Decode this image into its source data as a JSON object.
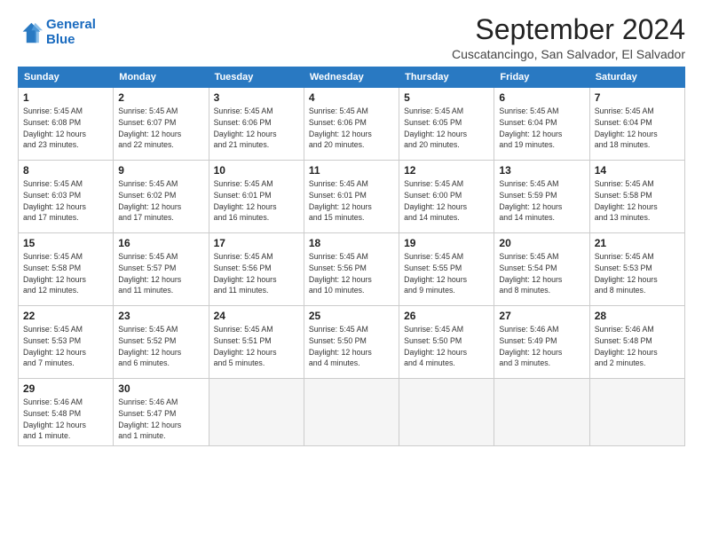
{
  "logo": {
    "line1": "General",
    "line2": "Blue"
  },
  "title": "September 2024",
  "location": "Cuscatancingo, San Salvador, El Salvador",
  "headers": [
    "Sunday",
    "Monday",
    "Tuesday",
    "Wednesday",
    "Thursday",
    "Friday",
    "Saturday"
  ],
  "weeks": [
    [
      {
        "day": "1",
        "info": "Sunrise: 5:45 AM\nSunset: 6:08 PM\nDaylight: 12 hours\nand 23 minutes."
      },
      {
        "day": "2",
        "info": "Sunrise: 5:45 AM\nSunset: 6:07 PM\nDaylight: 12 hours\nand 22 minutes."
      },
      {
        "day": "3",
        "info": "Sunrise: 5:45 AM\nSunset: 6:06 PM\nDaylight: 12 hours\nand 21 minutes."
      },
      {
        "day": "4",
        "info": "Sunrise: 5:45 AM\nSunset: 6:06 PM\nDaylight: 12 hours\nand 20 minutes."
      },
      {
        "day": "5",
        "info": "Sunrise: 5:45 AM\nSunset: 6:05 PM\nDaylight: 12 hours\nand 20 minutes."
      },
      {
        "day": "6",
        "info": "Sunrise: 5:45 AM\nSunset: 6:04 PM\nDaylight: 12 hours\nand 19 minutes."
      },
      {
        "day": "7",
        "info": "Sunrise: 5:45 AM\nSunset: 6:04 PM\nDaylight: 12 hours\nand 18 minutes."
      }
    ],
    [
      {
        "day": "8",
        "info": "Sunrise: 5:45 AM\nSunset: 6:03 PM\nDaylight: 12 hours\nand 17 minutes."
      },
      {
        "day": "9",
        "info": "Sunrise: 5:45 AM\nSunset: 6:02 PM\nDaylight: 12 hours\nand 17 minutes."
      },
      {
        "day": "10",
        "info": "Sunrise: 5:45 AM\nSunset: 6:01 PM\nDaylight: 12 hours\nand 16 minutes."
      },
      {
        "day": "11",
        "info": "Sunrise: 5:45 AM\nSunset: 6:01 PM\nDaylight: 12 hours\nand 15 minutes."
      },
      {
        "day": "12",
        "info": "Sunrise: 5:45 AM\nSunset: 6:00 PM\nDaylight: 12 hours\nand 14 minutes."
      },
      {
        "day": "13",
        "info": "Sunrise: 5:45 AM\nSunset: 5:59 PM\nDaylight: 12 hours\nand 14 minutes."
      },
      {
        "day": "14",
        "info": "Sunrise: 5:45 AM\nSunset: 5:58 PM\nDaylight: 12 hours\nand 13 minutes."
      }
    ],
    [
      {
        "day": "15",
        "info": "Sunrise: 5:45 AM\nSunset: 5:58 PM\nDaylight: 12 hours\nand 12 minutes."
      },
      {
        "day": "16",
        "info": "Sunrise: 5:45 AM\nSunset: 5:57 PM\nDaylight: 12 hours\nand 11 minutes."
      },
      {
        "day": "17",
        "info": "Sunrise: 5:45 AM\nSunset: 5:56 PM\nDaylight: 12 hours\nand 11 minutes."
      },
      {
        "day": "18",
        "info": "Sunrise: 5:45 AM\nSunset: 5:56 PM\nDaylight: 12 hours\nand 10 minutes."
      },
      {
        "day": "19",
        "info": "Sunrise: 5:45 AM\nSunset: 5:55 PM\nDaylight: 12 hours\nand 9 minutes."
      },
      {
        "day": "20",
        "info": "Sunrise: 5:45 AM\nSunset: 5:54 PM\nDaylight: 12 hours\nand 8 minutes."
      },
      {
        "day": "21",
        "info": "Sunrise: 5:45 AM\nSunset: 5:53 PM\nDaylight: 12 hours\nand 8 minutes."
      }
    ],
    [
      {
        "day": "22",
        "info": "Sunrise: 5:45 AM\nSunset: 5:53 PM\nDaylight: 12 hours\nand 7 minutes."
      },
      {
        "day": "23",
        "info": "Sunrise: 5:45 AM\nSunset: 5:52 PM\nDaylight: 12 hours\nand 6 minutes."
      },
      {
        "day": "24",
        "info": "Sunrise: 5:45 AM\nSunset: 5:51 PM\nDaylight: 12 hours\nand 5 minutes."
      },
      {
        "day": "25",
        "info": "Sunrise: 5:45 AM\nSunset: 5:50 PM\nDaylight: 12 hours\nand 4 minutes."
      },
      {
        "day": "26",
        "info": "Sunrise: 5:45 AM\nSunset: 5:50 PM\nDaylight: 12 hours\nand 4 minutes."
      },
      {
        "day": "27",
        "info": "Sunrise: 5:46 AM\nSunset: 5:49 PM\nDaylight: 12 hours\nand 3 minutes."
      },
      {
        "day": "28",
        "info": "Sunrise: 5:46 AM\nSunset: 5:48 PM\nDaylight: 12 hours\nand 2 minutes."
      }
    ],
    [
      {
        "day": "29",
        "info": "Sunrise: 5:46 AM\nSunset: 5:48 PM\nDaylight: 12 hours\nand 1 minute."
      },
      {
        "day": "30",
        "info": "Sunrise: 5:46 AM\nSunset: 5:47 PM\nDaylight: 12 hours\nand 1 minute."
      },
      {
        "day": "",
        "info": ""
      },
      {
        "day": "",
        "info": ""
      },
      {
        "day": "",
        "info": ""
      },
      {
        "day": "",
        "info": ""
      },
      {
        "day": "",
        "info": ""
      }
    ]
  ]
}
